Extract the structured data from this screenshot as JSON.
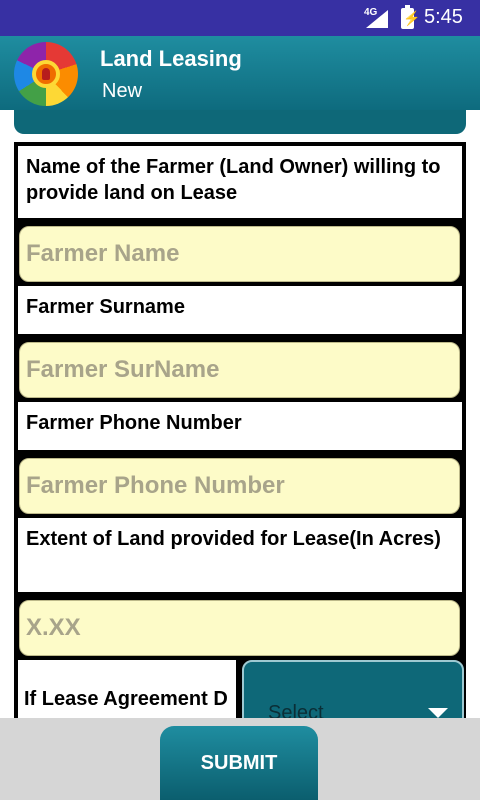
{
  "status_bar": {
    "network": "4G",
    "battery_glyph": "⚡",
    "time": "5:45"
  },
  "app_bar": {
    "title": "Land Leasing",
    "subtitle": "New"
  },
  "form": {
    "farmer_name_label": "Name of the Farmer (Land Owner) willing to provide land on Lease",
    "farmer_name_placeholder": "Farmer Name",
    "farmer_name_value": "",
    "surname_label": "Farmer Surname",
    "surname_placeholder": "Farmer SurName",
    "surname_value": "",
    "phone_label": "Farmer Phone Number",
    "phone_placeholder": "Farmer Phone Number",
    "phone_value": "",
    "extent_label": "Extent of Land provided for Lease(In Acres)",
    "extent_placeholder": "X.XX",
    "extent_value": "",
    "agreement_label": "If Lease Agreement D",
    "agreement_select": "Select"
  },
  "actions": {
    "submit_label": "SUBMIT"
  },
  "colors": {
    "status_bar": "#3730a3",
    "primary": "#0e6878",
    "input_bg": "#fdfbc8"
  }
}
